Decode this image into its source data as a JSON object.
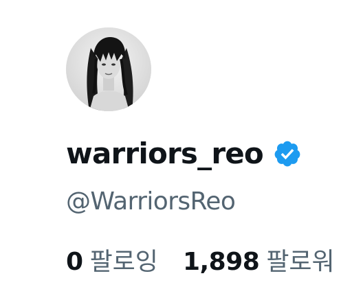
{
  "profile": {
    "avatar_alt": "avatar",
    "display_name": "warriors_reo",
    "handle": "@WarriorsReo",
    "verified_icon": "verified-badge-icon",
    "accent_color": "#1d9bf0"
  },
  "stats": {
    "following_count": "0",
    "following_label": "팔로잉",
    "followers_count": "1,898",
    "followers_label": "팔로워"
  },
  "colors": {
    "text_primary": "#0f1419",
    "text_secondary": "#536471",
    "background": "#ffffff"
  }
}
